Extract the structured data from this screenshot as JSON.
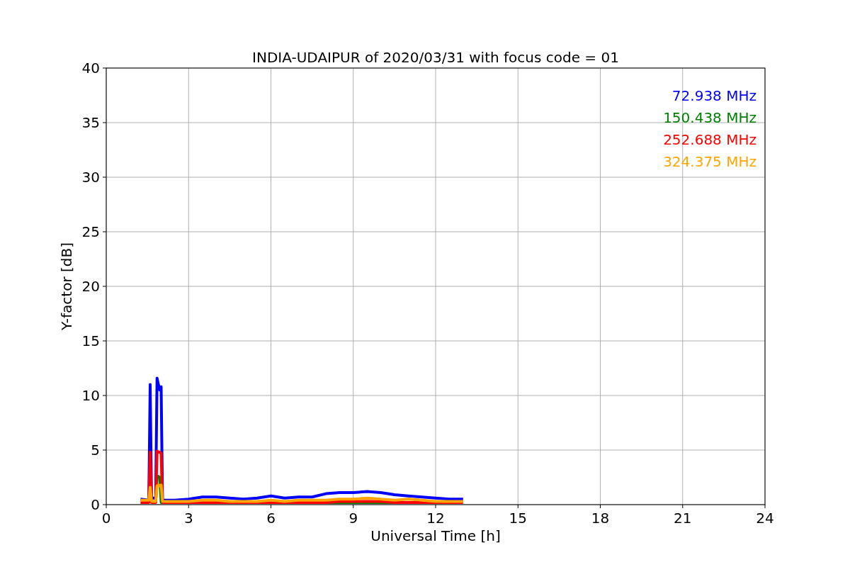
{
  "figure": {
    "chart_data": {
      "type": "line",
      "title": "INDIA-UDAIPUR of 2020/03/31 with focus code = 01",
      "xlabel": "Universal Time [h]",
      "ylabel": "Y-factor [dB]",
      "x": [
        1.25,
        1.55,
        1.6,
        1.65,
        1.8,
        1.85,
        1.9,
        1.95,
        2.0,
        2.05,
        2.5,
        3,
        3.5,
        4,
        4.5,
        5,
        5.5,
        6,
        6.5,
        7,
        7.5,
        8,
        8.5,
        9,
        9.5,
        10,
        10.5,
        11,
        11.5,
        12,
        12.5,
        13
      ],
      "series": [
        {
          "name": "72.938 MHz",
          "color": "#0000ff",
          "values": [
            0.5,
            0.4,
            11,
            0.6,
            0.6,
            11.6,
            11,
            10.5,
            10.8,
            0.4,
            0.4,
            0.5,
            0.7,
            0.7,
            0.6,
            0.5,
            0.6,
            0.8,
            0.6,
            0.7,
            0.7,
            1.0,
            1.1,
            1.1,
            1.2,
            1.1,
            0.9,
            0.8,
            0.7,
            0.6,
            0.5,
            0.5
          ]
        },
        {
          "name": "150.438 MHz",
          "color": "#008000",
          "values": [
            null,
            null,
            null,
            null,
            0.2,
            2.5,
            2.6,
            2.5,
            0.2,
            0.2,
            null,
            null,
            null,
            null,
            null,
            null,
            null,
            null,
            null,
            null,
            null,
            0.2,
            0.2,
            0.2,
            0.2,
            0.2,
            0.2,
            null,
            null,
            null,
            null,
            null
          ]
        },
        {
          "name": "252.688 MHz",
          "color": "#ff0000",
          "values": [
            0.2,
            0.2,
            4.8,
            0.2,
            0.2,
            4.9,
            4.8,
            4.8,
            4.7,
            0.2,
            0.2,
            0.2,
            0.2,
            0.2,
            0.2,
            0.2,
            0.2,
            0.2,
            0.2,
            0.2,
            0.2,
            0.2,
            0.3,
            0.3,
            0.3,
            0.3,
            0.2,
            0.2,
            0.2,
            0.2,
            0.2,
            0.2
          ]
        },
        {
          "name": "324.375 MHz",
          "color": "#ffa500",
          "values": [
            0.4,
            0.4,
            1.6,
            0.3,
            0.3,
            1.7,
            1.8,
            1.7,
            1.8,
            0.3,
            0.3,
            0.3,
            0.4,
            0.4,
            0.3,
            0.3,
            0.3,
            0.4,
            0.3,
            0.4,
            0.4,
            0.4,
            0.5,
            0.5,
            0.6,
            0.5,
            0.4,
            0.5,
            0.4,
            0.3,
            0.3,
            0.3
          ]
        }
      ],
      "xlim": [
        0,
        24
      ],
      "ylim": [
        0,
        40
      ],
      "grid": true,
      "xticks": [
        0,
        3,
        6,
        9,
        12,
        15,
        18,
        21,
        24
      ],
      "yticks": [
        0,
        5,
        10,
        15,
        20,
        25,
        30,
        35,
        40
      ]
    }
  }
}
